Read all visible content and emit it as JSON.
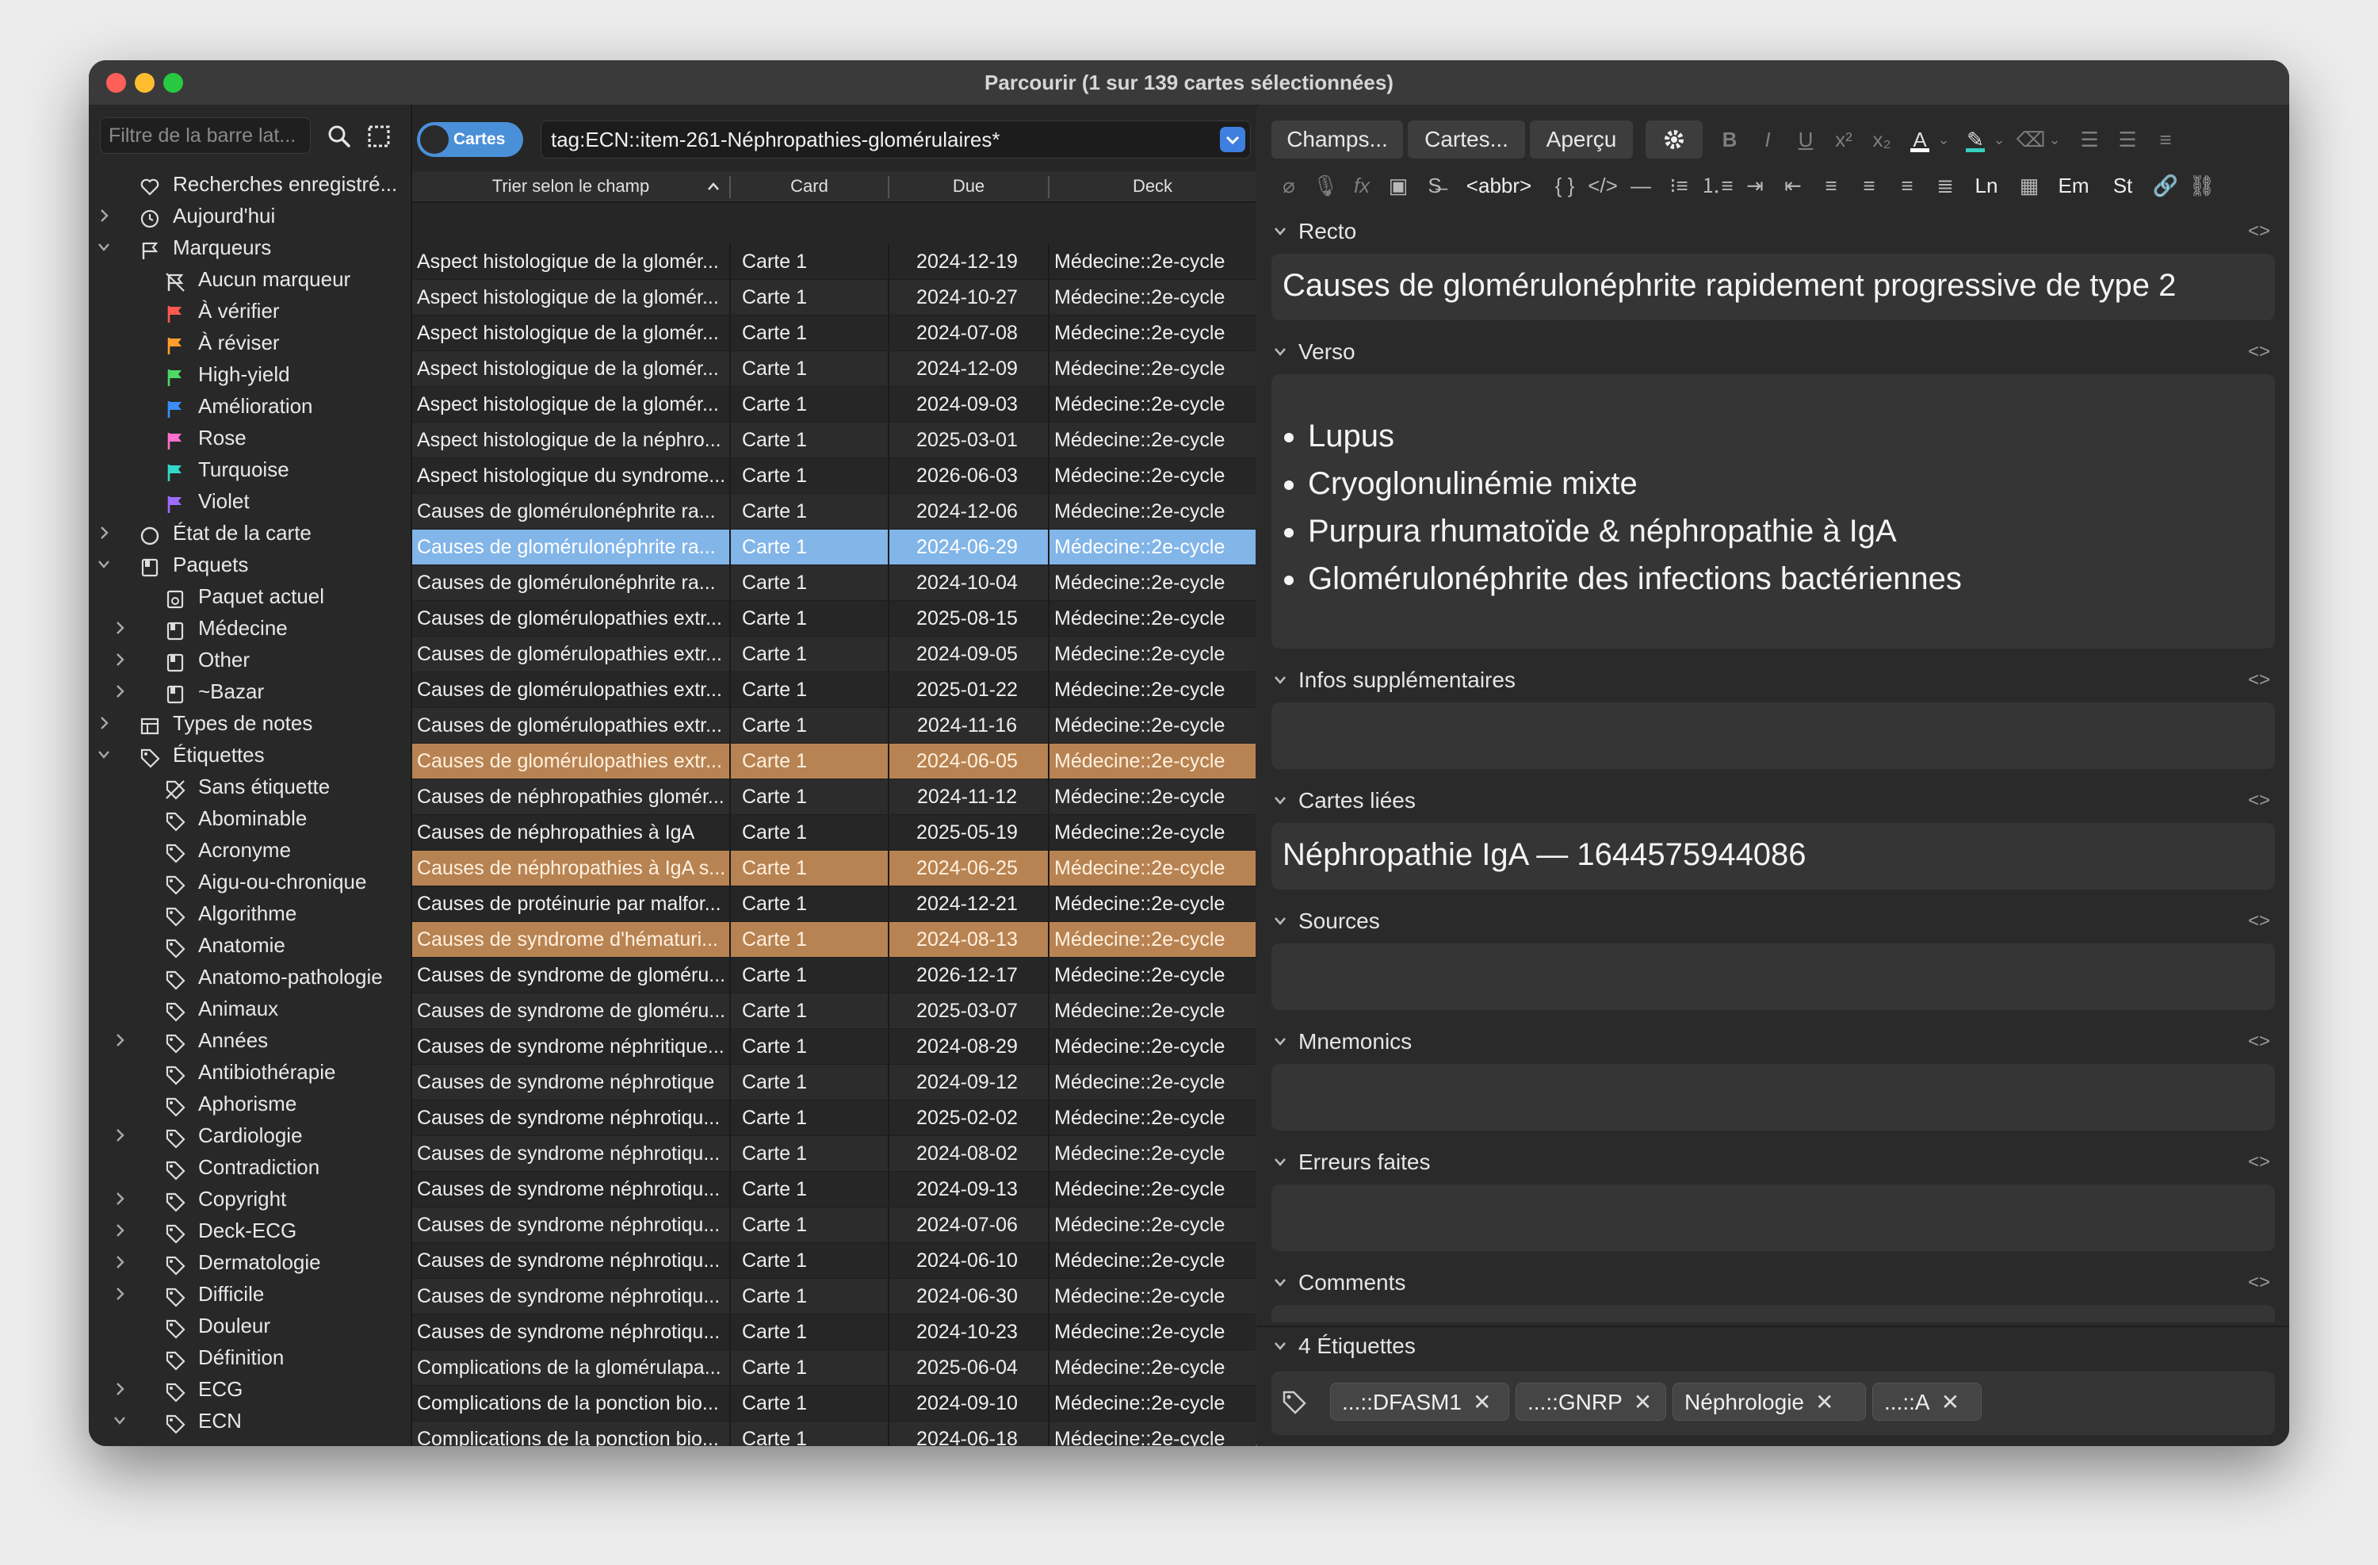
{
  "window": {
    "title": "Parcourir (1 sur 139 cartes sélectionnées)"
  },
  "sidebar": {
    "filter_placeholder": "Filtre de la barre lat...",
    "items": [
      {
        "label": "Recherches enregistré...",
        "icon": "heart-icon",
        "level": 0,
        "chev": ""
      },
      {
        "label": "Aujourd'hui",
        "icon": "clock-icon",
        "level": 0,
        "chev": "right"
      },
      {
        "label": "Marqueurs",
        "icon": "flag-icon",
        "level": 0,
        "chev": "down"
      },
      {
        "label": "Aucun marqueur",
        "icon": "flag-off-icon",
        "level": 1,
        "chev": ""
      },
      {
        "label": "À vérifier",
        "icon": "flag-red-icon",
        "level": 1,
        "chev": "",
        "color": "#ff5a4e"
      },
      {
        "label": "À réviser",
        "icon": "flag-orange-icon",
        "level": 1,
        "chev": "",
        "color": "#ff9e2c"
      },
      {
        "label": "High-yield",
        "icon": "flag-green-icon",
        "level": 1,
        "chev": "",
        "color": "#4cd964"
      },
      {
        "label": "Amélioration",
        "icon": "flag-blue-icon",
        "level": 1,
        "chev": "",
        "color": "#3a8ef6"
      },
      {
        "label": "Rose",
        "icon": "flag-pink-icon",
        "level": 1,
        "chev": "",
        "color": "#ff6fcf"
      },
      {
        "label": "Turquoise",
        "icon": "flag-turquoise-icon",
        "level": 1,
        "chev": "",
        "color": "#33d6c8"
      },
      {
        "label": "Violet",
        "icon": "flag-violet-icon",
        "level": 1,
        "chev": "",
        "color": "#a06cff"
      },
      {
        "label": "État de la carte",
        "icon": "circle-icon",
        "level": 0,
        "chev": "right"
      },
      {
        "label": "Paquets",
        "icon": "deck-icon",
        "level": 0,
        "chev": "down"
      },
      {
        "label": "Paquet actuel",
        "icon": "current-deck-icon",
        "level": 1,
        "chev": ""
      },
      {
        "label": "Médecine",
        "icon": "deck-icon",
        "level": 1,
        "chev": "right"
      },
      {
        "label": "Other",
        "icon": "deck-icon",
        "level": 1,
        "chev": "right"
      },
      {
        "label": "~Bazar",
        "icon": "deck-icon",
        "level": 1,
        "chev": "right"
      },
      {
        "label": "Types de notes",
        "icon": "note-type-icon",
        "level": 0,
        "chev": "right"
      },
      {
        "label": "Étiquettes",
        "icon": "tag-icon",
        "level": 0,
        "chev": "down"
      },
      {
        "label": "Sans étiquette",
        "icon": "tag-off-icon",
        "level": 1,
        "chev": ""
      },
      {
        "label": "Abominable",
        "icon": "tag-icon",
        "level": 1,
        "chev": ""
      },
      {
        "label": "Acronyme",
        "icon": "tag-icon",
        "level": 1,
        "chev": ""
      },
      {
        "label": "Aigu-ou-chronique",
        "icon": "tag-icon",
        "level": 1,
        "chev": ""
      },
      {
        "label": "Algorithme",
        "icon": "tag-icon",
        "level": 1,
        "chev": ""
      },
      {
        "label": "Anatomie",
        "icon": "tag-icon",
        "level": 1,
        "chev": ""
      },
      {
        "label": "Anatomo-pathologie",
        "icon": "tag-icon",
        "level": 1,
        "chev": ""
      },
      {
        "label": "Animaux",
        "icon": "tag-icon",
        "level": 1,
        "chev": ""
      },
      {
        "label": "Années",
        "icon": "tag-icon",
        "level": 1,
        "chev": "right"
      },
      {
        "label": "Antibiothérapie",
        "icon": "tag-icon",
        "level": 1,
        "chev": ""
      },
      {
        "label": "Aphorisme",
        "icon": "tag-icon",
        "level": 1,
        "chev": ""
      },
      {
        "label": "Cardiologie",
        "icon": "tag-icon",
        "level": 1,
        "chev": "right"
      },
      {
        "label": "Contradiction",
        "icon": "tag-icon",
        "level": 1,
        "chev": ""
      },
      {
        "label": "Copyright",
        "icon": "tag-icon",
        "level": 1,
        "chev": "right"
      },
      {
        "label": "Deck-ECG",
        "icon": "tag-icon",
        "level": 1,
        "chev": "right"
      },
      {
        "label": "Dermatologie",
        "icon": "tag-icon",
        "level": 1,
        "chev": "right"
      },
      {
        "label": "Difficile",
        "icon": "tag-icon",
        "level": 1,
        "chev": "right"
      },
      {
        "label": "Douleur",
        "icon": "tag-icon",
        "level": 1,
        "chev": ""
      },
      {
        "label": "Définition",
        "icon": "tag-icon",
        "level": 1,
        "chev": ""
      },
      {
        "label": "ECG",
        "icon": "tag-icon",
        "level": 1,
        "chev": "right"
      },
      {
        "label": "ECN",
        "icon": "tag-icon",
        "level": 1,
        "chev": "down"
      }
    ]
  },
  "list": {
    "toggle_label": "Cartes",
    "search_value": "tag:ECN::item-261-Néphropathies-glomérulaires*",
    "columns": [
      "Trier selon le champ",
      "Card",
      "Due",
      "Deck"
    ],
    "rows": [
      {
        "sort": "Aspect histologique de la glomér...",
        "card": "Carte 1",
        "due": "2024-12-19",
        "deck": "Médecine::2e-cycle",
        "state": ""
      },
      {
        "sort": "Aspect histologique de la glomér...",
        "card": "Carte 1",
        "due": "2024-10-27",
        "deck": "Médecine::2e-cycle",
        "state": ""
      },
      {
        "sort": "Aspect histologique de la glomér...",
        "card": "Carte 1",
        "due": "2024-07-08",
        "deck": "Médecine::2e-cycle",
        "state": ""
      },
      {
        "sort": "Aspect histologique de la glomér...",
        "card": "Carte 1",
        "due": "2024-12-09",
        "deck": "Médecine::2e-cycle",
        "state": ""
      },
      {
        "sort": "Aspect histologique de la glomér...",
        "card": "Carte 1",
        "due": "2024-09-03",
        "deck": "Médecine::2e-cycle",
        "state": ""
      },
      {
        "sort": "Aspect histologique de la néphro...",
        "card": "Carte 1",
        "due": "2025-03-01",
        "deck": "Médecine::2e-cycle",
        "state": ""
      },
      {
        "sort": "Aspect histologique du syndrome...",
        "card": "Carte 1",
        "due": "2026-06-03",
        "deck": "Médecine::2e-cycle",
        "state": ""
      },
      {
        "sort": "Causes de glomérulonéphrite ra...",
        "card": "Carte 1",
        "due": "2024-12-06",
        "deck": "Médecine::2e-cycle",
        "state": ""
      },
      {
        "sort": "Causes de glomérulonéphrite ra...",
        "card": "Carte 1",
        "due": "2024-06-29",
        "deck": "Médecine::2e-cycle",
        "state": "sel"
      },
      {
        "sort": "Causes de glomérulonéphrite ra...",
        "card": "Carte 1",
        "due": "2024-10-04",
        "deck": "Médecine::2e-cycle",
        "state": ""
      },
      {
        "sort": "Causes de glomérulopathies extr...",
        "card": "Carte 1",
        "due": "2025-08-15",
        "deck": "Médecine::2e-cycle",
        "state": ""
      },
      {
        "sort": "Causes de glomérulopathies extr...",
        "card": "Carte 1",
        "due": "2024-09-05",
        "deck": "Médecine::2e-cycle",
        "state": ""
      },
      {
        "sort": "Causes de glomérulopathies extr...",
        "card": "Carte 1",
        "due": "2025-01-22",
        "deck": "Médecine::2e-cycle",
        "state": ""
      },
      {
        "sort": "Causes de glomérulopathies extr...",
        "card": "Carte 1",
        "due": "2024-11-16",
        "deck": "Médecine::2e-cycle",
        "state": ""
      },
      {
        "sort": "Causes de glomérulopathies extr...",
        "card": "Carte 1",
        "due": "2024-06-05",
        "deck": "Médecine::2e-cycle",
        "state": "mark"
      },
      {
        "sort": "Causes de néphropathies glomér...",
        "card": "Carte 1",
        "due": "2024-11-12",
        "deck": "Médecine::2e-cycle",
        "state": ""
      },
      {
        "sort": "Causes de néphropathies à IgA",
        "card": "Carte 1",
        "due": "2025-05-19",
        "deck": "Médecine::2e-cycle",
        "state": ""
      },
      {
        "sort": "Causes de néphropathies à IgA s...",
        "card": "Carte 1",
        "due": "2024-06-25",
        "deck": "Médecine::2e-cycle",
        "state": "mark"
      },
      {
        "sort": "Causes de protéinurie par malfor...",
        "card": "Carte 1",
        "due": "2024-12-21",
        "deck": "Médecine::2e-cycle",
        "state": ""
      },
      {
        "sort": "Causes de syndrome d'hématuri...",
        "card": "Carte 1",
        "due": "2024-08-13",
        "deck": "Médecine::2e-cycle",
        "state": "mark"
      },
      {
        "sort": "Causes de syndrome de gloméru...",
        "card": "Carte 1",
        "due": "2026-12-17",
        "deck": "Médecine::2e-cycle",
        "state": ""
      },
      {
        "sort": "Causes de syndrome de gloméru...",
        "card": "Carte 1",
        "due": "2025-03-07",
        "deck": "Médecine::2e-cycle",
        "state": ""
      },
      {
        "sort": "Causes de syndrome néphritique...",
        "card": "Carte 1",
        "due": "2024-08-29",
        "deck": "Médecine::2e-cycle",
        "state": ""
      },
      {
        "sort": "Causes de syndrome néphrotique",
        "card": "Carte 1",
        "due": "2024-09-12",
        "deck": "Médecine::2e-cycle",
        "state": ""
      },
      {
        "sort": "Causes de syndrome néphrotiqu...",
        "card": "Carte 1",
        "due": "2025-02-02",
        "deck": "Médecine::2e-cycle",
        "state": ""
      },
      {
        "sort": "Causes de syndrome néphrotiqu...",
        "card": "Carte 1",
        "due": "2024-08-02",
        "deck": "Médecine::2e-cycle",
        "state": ""
      },
      {
        "sort": "Causes de syndrome néphrotiqu...",
        "card": "Carte 1",
        "due": "2024-09-13",
        "deck": "Médecine::2e-cycle",
        "state": ""
      },
      {
        "sort": "Causes de syndrome néphrotiqu...",
        "card": "Carte 1",
        "due": "2024-07-06",
        "deck": "Médecine::2e-cycle",
        "state": ""
      },
      {
        "sort": "Causes de syndrome néphrotiqu...",
        "card": "Carte 1",
        "due": "2024-06-10",
        "deck": "Médecine::2e-cycle",
        "state": ""
      },
      {
        "sort": "Causes de syndrome néphrotiqu...",
        "card": "Carte 1",
        "due": "2024-06-30",
        "deck": "Médecine::2e-cycle",
        "state": ""
      },
      {
        "sort": "Causes de syndrome néphrotiqu...",
        "card": "Carte 1",
        "due": "2024-10-23",
        "deck": "Médecine::2e-cycle",
        "state": ""
      },
      {
        "sort": "Complications de la glomérulapa...",
        "card": "Carte 1",
        "due": "2025-06-04",
        "deck": "Médecine::2e-cycle",
        "state": ""
      },
      {
        "sort": "Complications de la ponction bio...",
        "card": "Carte 1",
        "due": "2024-09-10",
        "deck": "Médecine::2e-cycle",
        "state": ""
      },
      {
        "sort": "Complications de la ponction bio...",
        "card": "Carte 1",
        "due": "2024-06-18",
        "deck": "Médecine::2e-cycle",
        "state": ""
      },
      {
        "sort": "Complications de la ponction bio...",
        "card": "Carte 1",
        "due": "2025-05-21",
        "deck": "Médecine::2e-cycle",
        "state": ""
      }
    ]
  },
  "editor": {
    "buttons": {
      "fields": "Champs...",
      "cards": "Cartes...",
      "preview": "Aperçu"
    },
    "format_labels": {
      "abbr": "<abbr>",
      "ln": "Ln",
      "em": "Em",
      "st": "St"
    },
    "code_toggle": "<>",
    "fields": {
      "recto": {
        "name": "Recto",
        "value": "Causes de glomérulonéphrite rapidement progressive de type 2"
      },
      "verso": {
        "name": "Verso",
        "items": [
          "Lupus",
          "Cryoglonulinémie mixte",
          "Purpura rhumatoïde & néphropathie à IgA",
          "Glomérulonéphrite des infections bactériennes"
        ]
      },
      "infos": {
        "name": "Infos supplémentaires"
      },
      "cartes_liees": {
        "name": "Cartes liées",
        "value": "Néphropathie IgA — 1644575944086"
      },
      "sources": {
        "name": "Sources"
      },
      "mnemonics": {
        "name": "Mnemonics"
      },
      "erreurs": {
        "name": "Erreurs faites"
      },
      "comments": {
        "name": "Comments"
      }
    },
    "tags_header": "4 Étiquettes",
    "tags": [
      "...::DFASM1",
      "...::GNRP",
      "Néphrologie",
      "...::A"
    ]
  }
}
